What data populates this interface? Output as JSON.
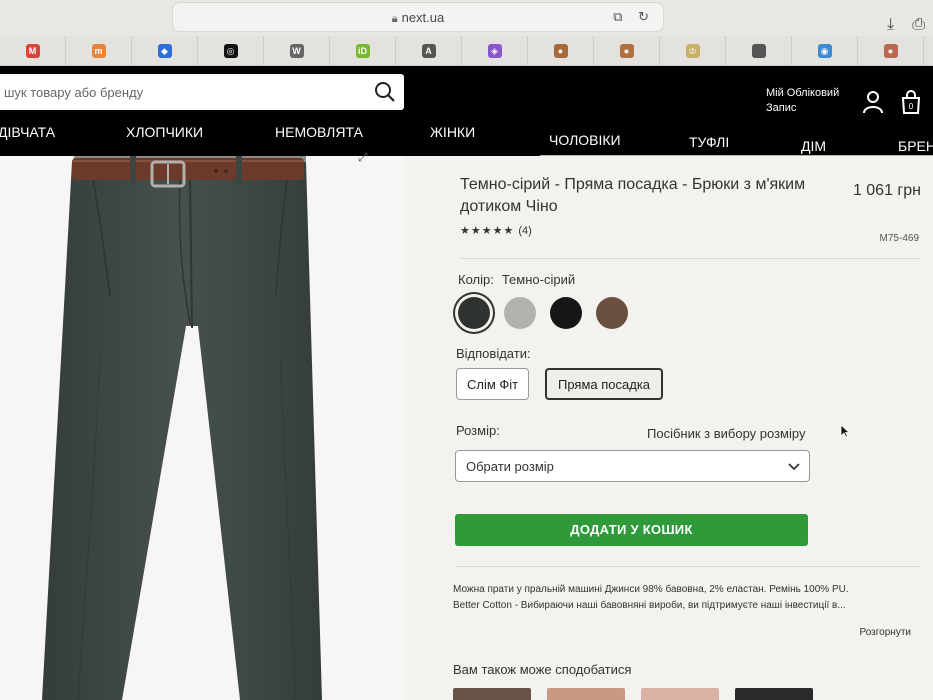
{
  "browser": {
    "url": "next.ua",
    "url_right_icons": "⧉ ↻",
    "right_icons": [
      "⤓",
      "⎙"
    ]
  },
  "bookmarks": [
    {
      "icon": "gmail-icon",
      "label": "M",
      "color": "#d44638"
    },
    {
      "icon": "mi-icon",
      "label": "m",
      "color": "#e8833a"
    },
    {
      "icon": "diamond-icon",
      "label": "◆",
      "color": "#2d6fd6"
    },
    {
      "icon": "openai-icon",
      "label": "◎",
      "color": "#111111"
    },
    {
      "icon": "w-icon",
      "label": "W",
      "color": "#666666"
    },
    {
      "icon": "id-icon",
      "label": "iD",
      "color": "#7ab832"
    },
    {
      "icon": "a-icon",
      "label": "A",
      "color": "#555555"
    },
    {
      "icon": "purple-icon",
      "label": "◈",
      "color": "#8a55c9"
    },
    {
      "icon": "avatar-icon-1",
      "label": "●",
      "color": "#a8683a"
    },
    {
      "icon": "avatar-icon-2",
      "label": "●",
      "color": "#b07040"
    },
    {
      "icon": "crest-icon",
      "label": "♔",
      "color": "#c9b06a"
    },
    {
      "icon": "apple-icon",
      "label": "",
      "color": "#555555"
    },
    {
      "icon": "globe-icon",
      "label": "◉",
      "color": "#3d8bd0"
    },
    {
      "icon": "avatar-icon-3",
      "label": "●",
      "color": "#b86a50"
    }
  ],
  "header": {
    "search_placeholder": "шук товару або бренду",
    "account_line1": "Мій Обліковий",
    "account_line2": "Запис",
    "bag_count": "0"
  },
  "nav": [
    "ДІВЧАТА",
    "ХЛОПЧИКИ",
    "НЕМОВЛЯТА",
    "ЖІНКИ",
    "ЧОЛОВІКИ",
    "ТУФЛІ",
    "ДІМ",
    "БРЕН"
  ],
  "product": {
    "title": "Темно-сірий - Пряма посадка - Брюки з м'яким дотиком Чіно",
    "price": "1 061 грн",
    "stars": "★★★★★",
    "rating_count": "(4)",
    "code": "M75-469",
    "color_label": "Колір:",
    "color_value": "Темно-сірий",
    "swatches": [
      "#2e3330",
      "#b3b1ad",
      "#161616",
      "#6b5040"
    ],
    "fit_label": "Відповідати:",
    "fits": [
      "Слім Фіт",
      "Пряма посадка"
    ],
    "size_label": "Розмір:",
    "size_guide": "Посібник з вибору розміру",
    "size_select": "Обрати розмір",
    "add_to_cart": "ДОДАТИ У КОШИК",
    "description_1": "Можна прати у пральній машині Джинси 98% бавовна, 2% еластан. Ремінь 100% PU.",
    "description_2": "Better Cotton - Вибираючи наші бавовняні вироби, ви підтримуєте наші інвестиції в...",
    "expand": "Розгорнути",
    "also_like": "Вам також може сподобатися"
  },
  "colors": {
    "header_bg": "#000000",
    "add_button": "#2e9a3a",
    "pants": "#3e4743"
  }
}
